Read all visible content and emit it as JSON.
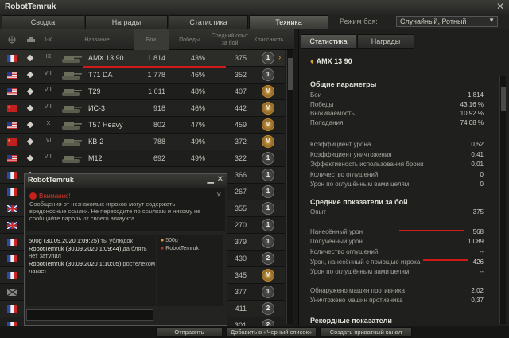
{
  "window": {
    "title": "RobotTemruk",
    "close": "✕"
  },
  "tabs": [
    "Сводка",
    "Награды",
    "Статистика",
    "Техника"
  ],
  "mode": {
    "label": "Режим боя:",
    "value": "Случайный, Ротный"
  },
  "table": {
    "headers": {
      "tier": "I-X",
      "name": "Название",
      "battles": "Бои",
      "wins": "Победы",
      "avgxp": "Средний опыт за бой",
      "mastery": "Классность"
    },
    "rows": [
      {
        "tier": "IX",
        "name": "AMX 13 90",
        "battles": "1 814",
        "wins": "43%",
        "avgxp": "375",
        "mastery": "1",
        "nation": "fr"
      },
      {
        "tier": "VIII",
        "name": "T71 DA",
        "battles": "1 778",
        "wins": "46%",
        "avgxp": "352",
        "mastery": "1",
        "nation": "us"
      },
      {
        "tier": "VIII",
        "name": "T29",
        "battles": "1 011",
        "wins": "48%",
        "avgxp": "407",
        "mastery": "M",
        "nation": "us"
      },
      {
        "tier": "VIII",
        "name": "ИС-3",
        "battles": "918",
        "wins": "46%",
        "avgxp": "442",
        "mastery": "M",
        "nation": "su"
      },
      {
        "tier": "X",
        "name": "T57 Heavy",
        "battles": "802",
        "wins": "47%",
        "avgxp": "459",
        "mastery": "M",
        "nation": "us"
      },
      {
        "tier": "VI",
        "name": "КВ-2",
        "battles": "788",
        "wins": "49%",
        "avgxp": "372",
        "mastery": "M",
        "nation": "su"
      },
      {
        "tier": "VIII",
        "name": "M12",
        "battles": "692",
        "wins": "49%",
        "avgxp": "322",
        "mastery": "1",
        "nation": "us"
      },
      {
        "tier": "",
        "name": "",
        "battles": "",
        "wins": "",
        "avgxp": "366",
        "mastery": "1",
        "nation": "fr"
      },
      {
        "tier": "",
        "name": "",
        "battles": "",
        "wins": "",
        "avgxp": "267",
        "mastery": "1",
        "nation": "fr"
      },
      {
        "tier": "",
        "name": "",
        "battles": "",
        "wins": "",
        "avgxp": "355",
        "mastery": "1",
        "nation": "uk"
      },
      {
        "tier": "",
        "name": "",
        "battles": "",
        "wins": "",
        "avgxp": "270",
        "mastery": "1",
        "nation": "uk"
      },
      {
        "tier": "",
        "name": "",
        "battles": "",
        "wins": "",
        "avgxp": "379",
        "mastery": "1",
        "nation": "fr"
      },
      {
        "tier": "",
        "name": "",
        "battles": "",
        "wins": "",
        "avgxp": "430",
        "mastery": "2",
        "nation": "fr"
      },
      {
        "tier": "",
        "name": "",
        "battles": "",
        "wins": "",
        "avgxp": "345",
        "mastery": "M",
        "nation": "fr"
      },
      {
        "tier": "",
        "name": "",
        "battles": "",
        "wins": "",
        "avgxp": "377",
        "mastery": "1",
        "nation": "de"
      },
      {
        "tier": "",
        "name": "",
        "battles": "",
        "wins": "",
        "avgxp": "411",
        "mastery": "2",
        "nation": "fr"
      },
      {
        "tier": "",
        "name": "",
        "battles": "",
        "wins": "",
        "avgxp": "301",
        "mastery": "2",
        "nation": "fr"
      }
    ]
  },
  "right": {
    "tabs": [
      "Статистика",
      "Награды"
    ],
    "vehicle": "AMX 13 90",
    "general": {
      "title": "Общие параметры",
      "rows": [
        {
          "label": "Бои",
          "value": "1 814"
        },
        {
          "label": "Победы",
          "value": "43,16 %"
        },
        {
          "label": "Выживаемость",
          "value": "10,92 %"
        },
        {
          "label": "Попадания",
          "value": "74,08 %"
        }
      ]
    },
    "extra": [
      {
        "label": "Коэффициент урона",
        "value": "0,52"
      },
      {
        "label": "Коэффициент уничтожения",
        "value": "0,41"
      },
      {
        "label": "Эффективность использования брони",
        "value": "0,01"
      },
      {
        "label": "Количество оглушений",
        "value": "0"
      },
      {
        "label": "Урон по оглушённым вами целям",
        "value": "0"
      }
    ],
    "avg": {
      "title": "Средние показатели за бой",
      "rows": [
        {
          "label": "Опыт",
          "value": "375"
        },
        {
          "label": "Нанесённый урон",
          "value": "568"
        },
        {
          "label": "Полученный урон",
          "value": "1 089"
        },
        {
          "label": "Количество оглушений",
          "value": "--"
        },
        {
          "label": "Урон, нанесённый с помощью игрока",
          "value": "426"
        },
        {
          "label": "Урон по оглушённым вами целям",
          "value": "--"
        },
        {
          "label": "Обнаружено машин противника",
          "value": "2,02"
        },
        {
          "label": "Уничтожено машин противника",
          "value": "0,37"
        }
      ]
    },
    "records_title": "Рекордные показатели"
  },
  "chat": {
    "title": "RobotTemruk",
    "warning_title": "Внимание!",
    "warning_text": "Сообщения от незнакомых игроков могут содержать вредоносные ссылки. Не переходите по ссылкам и никому не сообщайте пароль от своего аккаунта.",
    "messages": [
      {
        "author": "500g (30.09.2020 1:09:25)",
        "text": " ты ублюдок"
      },
      {
        "author": "RobotTemruk (30.09.2020 1:09:44)",
        "text": " да блять нет затупил"
      },
      {
        "author": "RobotTemruk (30.09.2020 1:10:05)",
        "text": " ростелеком лагает"
      }
    ],
    "members": [
      "500g",
      "RobotTemruk"
    ],
    "send": "Отправить"
  },
  "bottom": {
    "blacklist": "Добавить в «Черный список»",
    "private": "Создать приватный канал"
  },
  "colors": {
    "accent": "#d9a030",
    "red": "#d01a1a"
  }
}
